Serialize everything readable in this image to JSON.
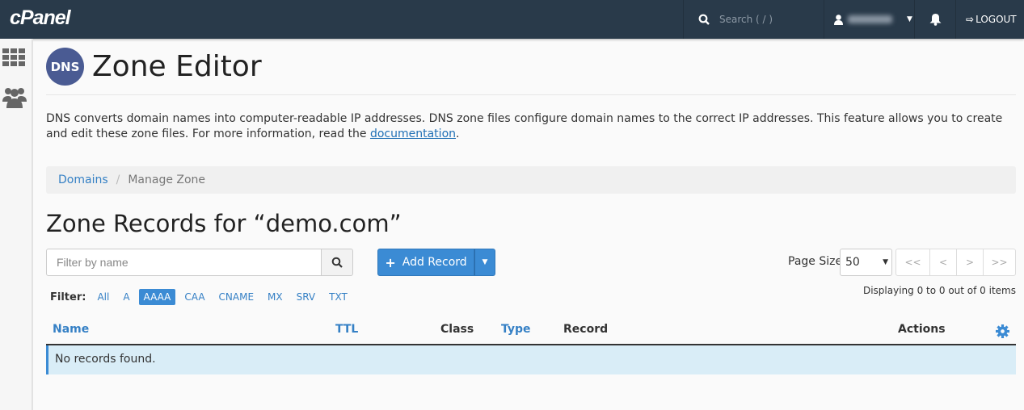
{
  "topbar": {
    "logo": "cPanel",
    "search_placeholder": "Search ( / )",
    "logout": "LOGOUT"
  },
  "page": {
    "title": "Zone Editor",
    "icon_text": "DNS",
    "description": "DNS converts domain names into computer-readable IP addresses. DNS zone files configure domain names to the correct IP addresses. This feature allows you to create and edit these zone files. For more information, read the ",
    "doc_link": "documentation",
    "desc_end": "."
  },
  "breadcrumb": {
    "items": [
      "Domains",
      "Manage Zone"
    ]
  },
  "zone_heading": "Zone Records for “demo.com”",
  "controls": {
    "filter_placeholder": "Filter by name",
    "add_record": "Add Record",
    "page_size_label": "Page Size",
    "page_size": "50",
    "pager": [
      "<<",
      "<",
      ">",
      ">>"
    ],
    "displaying": "Displaying 0 to 0 out of 0 items"
  },
  "filter": {
    "label": "Filter:",
    "types": [
      "All",
      "A",
      "AAAA",
      "CAA",
      "CNAME",
      "MX",
      "SRV",
      "TXT"
    ],
    "active": "AAAA"
  },
  "table": {
    "columns": [
      "Name",
      "TTL",
      "Class",
      "Type",
      "Record",
      "Actions"
    ],
    "empty": "No records found."
  },
  "colors": {
    "topbar": "#293a4a",
    "accent": "#3b8bd4",
    "empty_row": "#d9edf7"
  }
}
